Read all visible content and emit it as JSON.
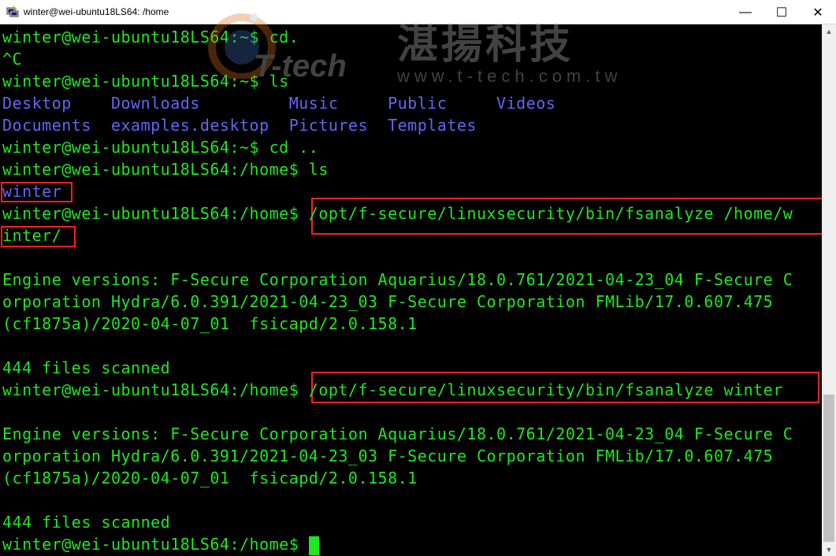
{
  "window": {
    "title": "winter@wei-ubuntu18LS64: /home",
    "controls": {
      "minimize": "—",
      "maximize": "☐",
      "close": "✕"
    }
  },
  "terminal": {
    "lines": [
      {
        "text": "winter@wei-ubuntu18LS64:~$ cd.",
        "color": "green"
      },
      {
        "text": "^C",
        "color": "green"
      },
      {
        "text": "winter@wei-ubuntu18LS64:~$ ls",
        "color": "green"
      },
      {
        "text": "Desktop    Downloads         Music     Public     Videos",
        "color": "blue"
      },
      {
        "text": "Documents  examples.desktop  Pictures  Templates",
        "color": "blue"
      },
      {
        "text": "winter@wei-ubuntu18LS64:~$ cd ..",
        "color": "green"
      },
      {
        "text": "winter@wei-ubuntu18LS64:/home$ ls",
        "color": "green"
      },
      {
        "text": "winter",
        "color": "blue"
      },
      {
        "text": "winter@wei-ubuntu18LS64:/home$ /opt/f-secure/linuxsecurity/bin/fsanalyze /home/w",
        "color": "green"
      },
      {
        "text": "inter/",
        "color": "green"
      },
      {
        "text": "",
        "color": "green"
      },
      {
        "text": "Engine versions: F-Secure Corporation Aquarius/18.0.761/2021-04-23_04 F-Secure C",
        "color": "green"
      },
      {
        "text": "orporation Hydra/6.0.391/2021-04-23_03 F-Secure Corporation FMLib/17.0.607.475",
        "color": "green"
      },
      {
        "text": "(cf1875a)/2020-04-07_01  fsicapd/2.0.158.1",
        "color": "green"
      },
      {
        "text": "",
        "color": "green"
      },
      {
        "text": "444 files scanned",
        "color": "green"
      },
      {
        "text": "winter@wei-ubuntu18LS64:/home$ /opt/f-secure/linuxsecurity/bin/fsanalyze winter",
        "color": "green"
      },
      {
        "text": "",
        "color": "green"
      },
      {
        "text": "Engine versions: F-Secure Corporation Aquarius/18.0.761/2021-04-23_04 F-Secure C",
        "color": "green"
      },
      {
        "text": "orporation Hydra/6.0.391/2021-04-23_03 F-Secure Corporation FMLib/17.0.607.475",
        "color": "green"
      },
      {
        "text": "(cf1875a)/2020-04-07_01  fsicapd/2.0.158.1",
        "color": "green"
      },
      {
        "text": "",
        "color": "green"
      },
      {
        "text": "444 files scanned",
        "color": "green"
      },
      {
        "text": "winter@wei-ubuntu18LS64:/home$ ",
        "color": "green"
      }
    ]
  },
  "watermark": {
    "logo": "T-tech",
    "chinese": "湛揚科技",
    "url": "www.t-tech.com.tw"
  },
  "colors": {
    "green": "#1ee81e",
    "blue": "#6464f5",
    "highlight": "#ff1f1f",
    "background": "#000000"
  }
}
